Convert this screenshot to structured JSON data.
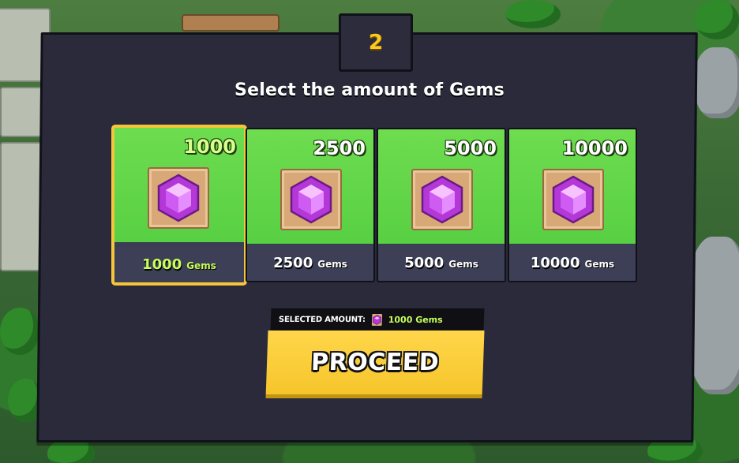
{
  "dialog": {
    "step": "2",
    "title": "Select the amount of Gems"
  },
  "gem_options": [
    {
      "amount": "1000",
      "label_amount": "1000",
      "unit": "Gems",
      "selected": true,
      "icon": "gem-icon"
    },
    {
      "amount": "2500",
      "label_amount": "2500",
      "unit": "Gems",
      "selected": false,
      "icon": "gem-icon"
    },
    {
      "amount": "5000",
      "label_amount": "5000",
      "unit": "Gems",
      "selected": false,
      "icon": "gem-icon"
    },
    {
      "amount": "10000",
      "label_amount": "10000",
      "unit": "Gems",
      "selected": false,
      "icon": "gem-icon"
    }
  ],
  "selection": {
    "label": "SELECTED AMOUNT:",
    "value": "1000 Gems",
    "icon": "gem-icon"
  },
  "proceed_button": {
    "label": "PROCEED"
  },
  "colors": {
    "accent_yellow": "#f6c53a",
    "card_green": "#5fd447",
    "panel_dark": "#2a2a3a",
    "gem_purple": "#c24fe6"
  }
}
